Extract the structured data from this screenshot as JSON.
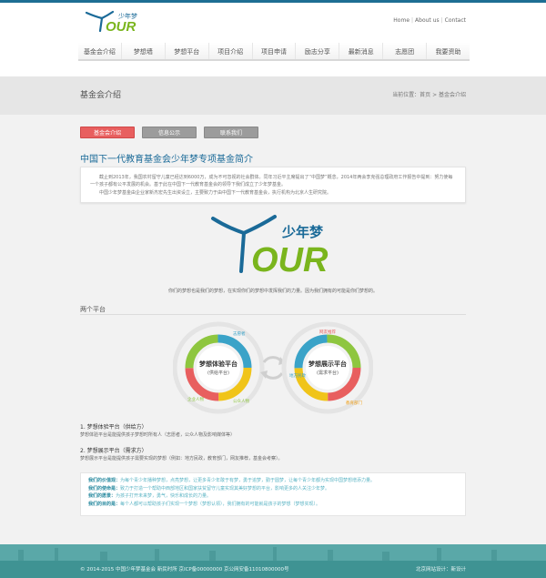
{
  "header": {
    "logo_cn": "少年梦",
    "logo_en": "OUR",
    "links": [
      "Home",
      "About us",
      "Contact"
    ]
  },
  "nav": {
    "items": [
      "基金会介绍",
      "梦想墙",
      "梦想平台",
      "项目介绍",
      "项目申请",
      "励志分享",
      "最新消息",
      "志愿团",
      "我要资助"
    ]
  },
  "banner": {
    "title": "基金会介绍",
    "breadcrumb": "当前位置：首页 > 基金会介绍"
  },
  "subtabs": [
    "基金会介绍",
    "信息公示",
    "联系我们"
  ],
  "page": {
    "heading": "中国下一代教育基金会少年梦专项基金简介",
    "intro_p1": "截止到2013年，我国农村留守儿童已经达到6000万，成为不可忽视的社会群体。同年习近平主席提出了“中国梦”概念，2014年两会李克强总理政府工作报告中提到：努力使每一个孩子都有公平发展的机会。基于此在中国下一代教育基金会的领导下我们成立了少年梦基金。",
    "intro_p2": "中国少年梦基金由企业家新杰宏先生出资设立，主要致力于由中国下一代教育基金会，执行机构为北京人生研究院。",
    "slogan": "你们的梦想也是我们的梦想，在实现你们的梦想中发挥我们的力量。因为我们拥有的可能是你们梦想的。",
    "two_platforms": "两个平台",
    "diagram": {
      "left_main": "梦想体验平台",
      "left_sub": "(供给平台)",
      "right_main": "梦想展示平台",
      "right_sub": "(需求平台)",
      "left_label_top": "志愿者",
      "left_label_bottom_left": "企业人物",
      "left_label_bottom_right": "公众人物",
      "right_label_top": "网友推荐",
      "right_label_left": "地方民政",
      "right_label_right": "教育部门"
    },
    "section1_title": "1. 梦想体验平台（供给方）",
    "section1_desc": "梦想体验平台是能提供孩子梦想时所有人（志愿者，公众人物及影响媒体等）",
    "section2_title": "2. 梦想展示平台（需求方）",
    "section2_desc": "梦想展示平台是能提供孩子需要实现的梦想（例如：地方民政，教育部门，网友推荐，基金会考察）。",
    "info_rows": [
      {
        "key": "我们的价值观：",
        "value": "为每个青少年播种梦想，点亮梦想，让更多青少年敢于有梦，勇于追梦，勤于圆梦，让每个青少年都为实现中国梦想增添力量。"
      },
      {
        "key": "我们的使命是：",
        "value": "致力于打造一个帮助中西部地区和国家扶贫留守儿童实现其美好梦想的平台，影响更多的人关注少年梦。"
      },
      {
        "key": "我们的愿景：",
        "value": "为孩子打开未来梦，勇气，快乐和成长的力量。"
      },
      {
        "key": "我们的目的是：",
        "value": "每个人都可以帮助孩子们实现一个梦想（梦想认领），我们拥有的可能就是孩子的梦想（梦想实现）。"
      }
    ]
  },
  "footer": {
    "left": "© 2014-2015  中国少年梦基金会  新民时所  京ICP备00000000    京公网安备11010800000号",
    "right": "北京网站设计：新设计"
  },
  "colors": {
    "brand_blue": "#1a6a98",
    "brand_green": "#7ab51d",
    "accent_red": "#e85f5f",
    "footer_teal": "#3f9393"
  }
}
